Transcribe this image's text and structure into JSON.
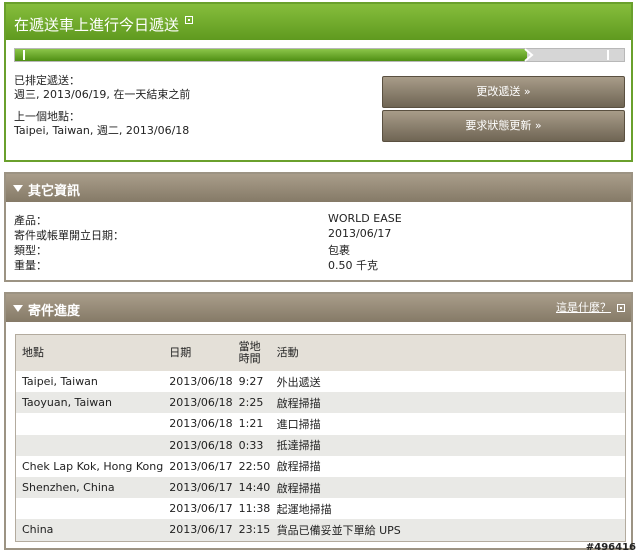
{
  "status": {
    "title": "在遞送車上進行今日遞送",
    "progress_fraction": 0.84,
    "scheduled_label": "已排定遞送：",
    "scheduled_value": "週三, 2013/06/19, 在一天結束之前",
    "last_location_label": "上一個地點：",
    "last_location_value": "Taipei, Taiwan, 週二, 2013/06/18",
    "change_delivery_button": "更改遞送 »",
    "request_update_button": "要求狀態更新 »"
  },
  "details": {
    "title": "其它資訊",
    "rows": [
      {
        "label": "產品：",
        "value": "WORLD EASE"
      },
      {
        "label": "寄件或帳單開立日期：",
        "value": "2013/06/17"
      },
      {
        "label": "類型：",
        "value": "包裹"
      },
      {
        "label": "重量：",
        "value": "0.50 千克"
      }
    ]
  },
  "progress": {
    "title": "寄件進度",
    "help_link": "這是什麼？",
    "headers": {
      "location": "地點",
      "date": "日期",
      "local_time": "當地時間",
      "activity": "活動"
    },
    "rows": [
      {
        "location": "Taipei, Taiwan",
        "date": "2013/06/18",
        "time": "9:27",
        "activity": "外出遞送"
      },
      {
        "location": "Taoyuan, Taiwan",
        "date": "2013/06/18",
        "time": "2:25",
        "activity": "啟程掃描"
      },
      {
        "location": "",
        "date": "2013/06/18",
        "time": "1:21",
        "activity": "進口掃描"
      },
      {
        "location": "",
        "date": "2013/06/18",
        "time": "0:33",
        "activity": "抵達掃描"
      },
      {
        "location": "Chek Lap Kok, Hong Kong",
        "date": "2013/06/17",
        "time": "22:50",
        "activity": "啟程掃描"
      },
      {
        "location": "Shenzhen, China",
        "date": "2013/06/17",
        "time": "14:40",
        "activity": "啟程掃描"
      },
      {
        "location": "",
        "date": "2013/06/17",
        "time": "11:38",
        "activity": "起運地掃描"
      },
      {
        "location": "China",
        "date": "2013/06/17",
        "time": "23:15",
        "activity": "貨品已備妥並下單給 UPS"
      }
    ]
  },
  "watermark": "#496416",
  "colors": {
    "status_green": "#6aa02c",
    "section_brown": "#9c9383",
    "button_brown": "#7a6f5e"
  }
}
